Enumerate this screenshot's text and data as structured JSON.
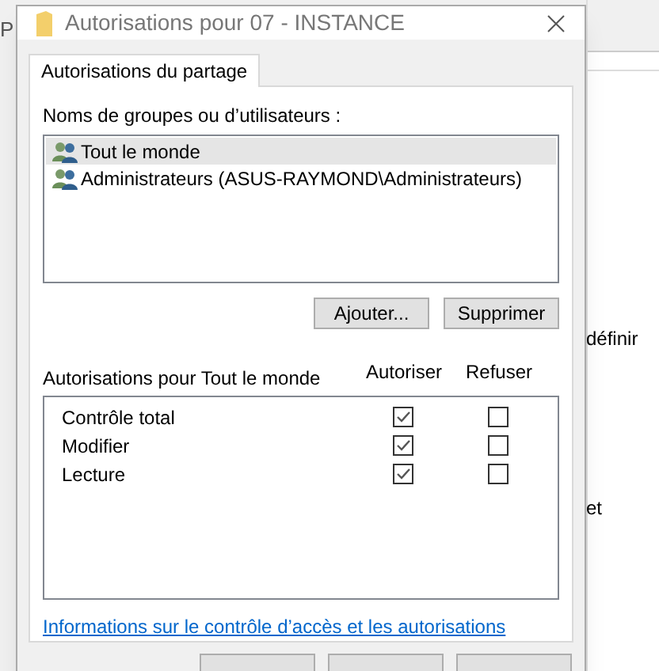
{
  "background_window": {
    "texts": [
      "P",
      "définir",
      "et"
    ]
  },
  "window": {
    "title": "Autorisations pour 07 - INSTANCE"
  },
  "tabs": [
    {
      "label": "Autorisations du partage",
      "selected": true
    }
  ],
  "users": {
    "label": "Noms de groupes ou d’utilisateurs :",
    "items": [
      {
        "name": "Tout le monde",
        "selected": true
      },
      {
        "name": "Administrateurs (ASUS-RAYMOND\\Administrateurs)",
        "selected": false
      }
    ],
    "buttons": [
      "Ajouter...",
      "Supprimer"
    ]
  },
  "permissions": {
    "label": "Autorisations pour Tout le monde",
    "columns": [
      "Autoriser",
      "Refuser"
    ],
    "rows": [
      {
        "name": "Contrôle total",
        "allow": true,
        "deny": false
      },
      {
        "name": "Modifier",
        "allow": true,
        "deny": false
      },
      {
        "name": "Lecture",
        "allow": true,
        "deny": false
      }
    ]
  },
  "link": "Informations sur le contrôle d’accès et les autorisations"
}
